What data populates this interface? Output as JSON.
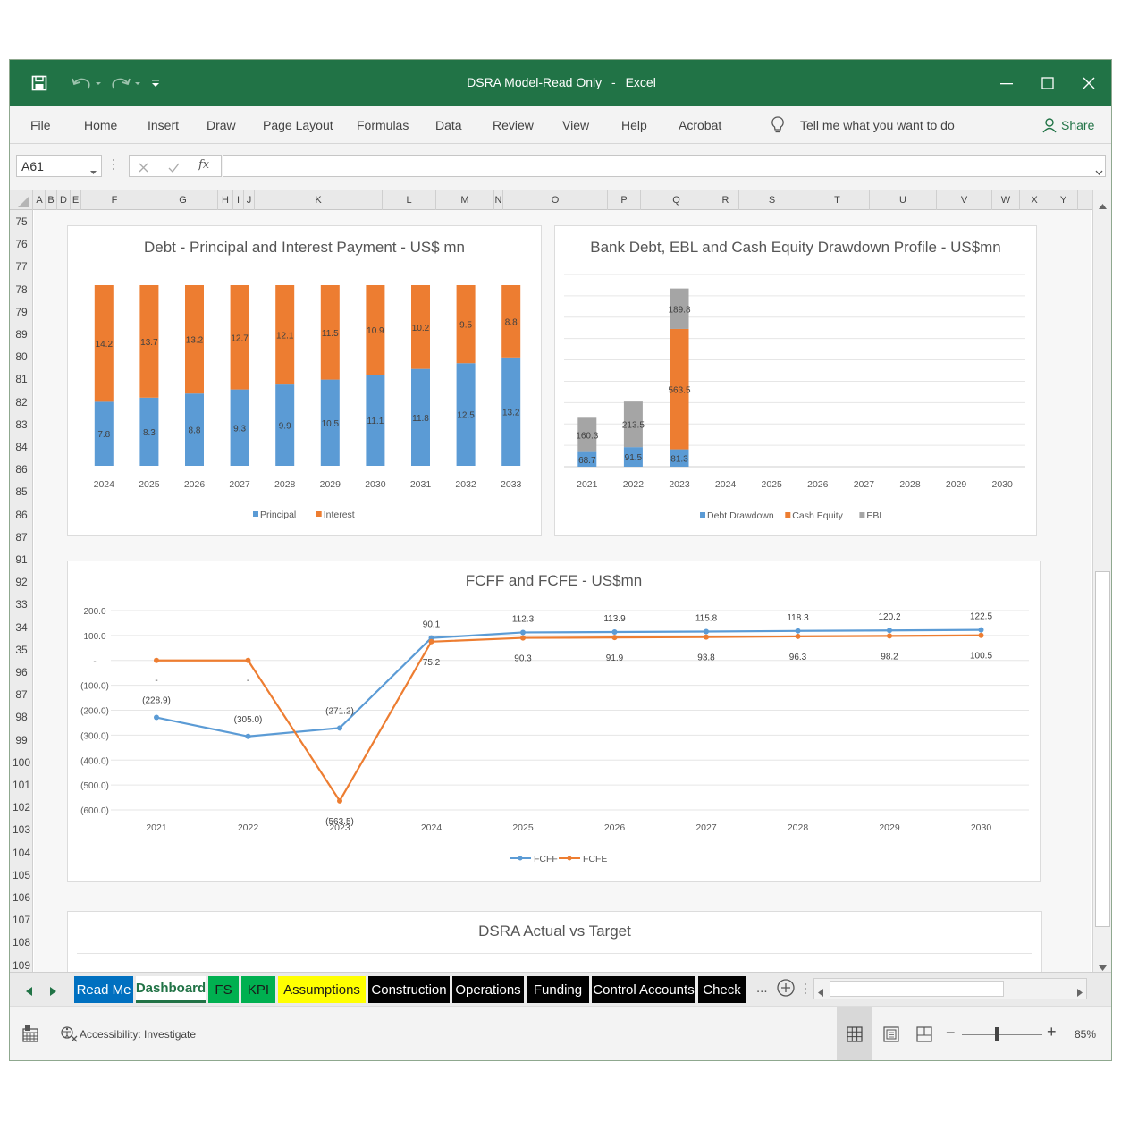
{
  "window": {
    "title": "DSRA Model-Read Only",
    "title_sep": "-",
    "app": "Excel",
    "brand_color": "#217346",
    "quick_access_icons": [
      "save-icon",
      "undo-icon",
      "redo-icon",
      "customize-icon"
    ],
    "window_controls": [
      "minimize-icon",
      "maximize-icon",
      "close-icon"
    ]
  },
  "ribbon": {
    "tabs": [
      "File",
      "Home",
      "Insert",
      "Draw",
      "Page Layout",
      "Formulas",
      "Data",
      "Review",
      "View",
      "Help",
      "Acrobat"
    ],
    "tell_me": "Tell me what you want to do",
    "share": "Share"
  },
  "formula_bar": {
    "name_box": "A61",
    "fx_label": "fx",
    "value": ""
  },
  "grid": {
    "columns": [
      "A",
      "B",
      "D",
      "E",
      "F",
      "G",
      "H",
      "I",
      "J",
      "K",
      "L",
      "M",
      "N",
      "O",
      "P",
      "Q",
      "R",
      "S",
      "T",
      "U",
      "V",
      "W",
      "X",
      "Y"
    ],
    "rows": [
      "75",
      "76",
      "77",
      "78",
      "79",
      "89",
      "80",
      "81",
      "82",
      "83",
      "84",
      "86",
      "85",
      "86",
      "87",
      "91",
      "92",
      "33",
      "34",
      "35",
      "96",
      "87",
      "98",
      "99",
      "100",
      "101",
      "102",
      "103",
      "104",
      "105",
      "106",
      "107",
      "108",
      "109"
    ]
  },
  "chart_data": [
    {
      "id": "chart1",
      "type": "bar",
      "stacked": true,
      "title": "Debt - Principal and Interest Payment - US$ mn",
      "categories": [
        "2024",
        "2025",
        "2026",
        "2027",
        "2028",
        "2029",
        "2030",
        "2031",
        "2032",
        "2033"
      ],
      "series": [
        {
          "name": "Principal",
          "color": "#5b9bd5",
          "values": [
            7.8,
            8.3,
            8.8,
            9.3,
            9.9,
            10.5,
            11.1,
            11.8,
            12.5,
            13.2
          ]
        },
        {
          "name": "Interest",
          "color": "#ed7d31",
          "values": [
            14.2,
            13.7,
            13.2,
            12.7,
            12.1,
            11.5,
            10.9,
            10.2,
            9.5,
            8.8
          ]
        }
      ],
      "ylim": [
        0,
        22
      ],
      "grid": false,
      "legend": "bottom"
    },
    {
      "id": "chart2",
      "type": "bar",
      "stacked": true,
      "title": "Bank Debt, EBL and Cash Equity Drawdown Profile - US$mn",
      "categories": [
        "2021",
        "2022",
        "2023",
        "2024",
        "2025",
        "2026",
        "2027",
        "2028",
        "2029",
        "2030"
      ],
      "series": [
        {
          "name": "Debt Drawdown",
          "color": "#5b9bd5",
          "values": [
            68.7,
            91.5,
            81.3,
            0,
            0,
            0,
            0,
            0,
            0,
            0
          ]
        },
        {
          "name": "Cash Equity",
          "color": "#ed7d31",
          "values": [
            0,
            0,
            563.5,
            0,
            0,
            0,
            0,
            0,
            0,
            0
          ]
        },
        {
          "name": "EBL",
          "color": "#a5a5a5",
          "values": [
            160.3,
            213.5,
            189.8,
            0,
            0,
            0,
            0,
            0,
            0,
            0
          ]
        }
      ],
      "ylim": [
        0,
        900
      ],
      "grid": true,
      "legend": "bottom"
    },
    {
      "id": "chart3",
      "type": "line",
      "title": "FCFF and FCFE - US$mn",
      "categories": [
        "2021",
        "2022",
        "2023",
        "2024",
        "2025",
        "2026",
        "2027",
        "2028",
        "2029",
        "2030"
      ],
      "yticks": [
        "200.0",
        "100.0",
        "-",
        "(100.0)",
        "(200.0)",
        "(300.0)",
        "(400.0)",
        "(500.0)",
        "(600.0)"
      ],
      "ylim": [
        -600,
        200
      ],
      "series": [
        {
          "name": "FCFF",
          "color": "#5b9bd5",
          "values": [
            -228.9,
            -305.0,
            -271.2,
            90.1,
            112.3,
            113.9,
            115.8,
            118.3,
            120.2,
            122.5
          ],
          "labels": [
            "(228.9)",
            "(305.0)",
            "(271.2)",
            "90.1",
            "112.3",
            "113.9",
            "115.8",
            "118.3",
            "120.2",
            "122.5"
          ]
        },
        {
          "name": "FCFE",
          "color": "#ed7d31",
          "values": [
            0,
            0,
            -563.5,
            75.2,
            90.3,
            91.9,
            93.8,
            96.3,
            98.2,
            100.5
          ],
          "labels": [
            "-",
            "-",
            "(563.5)",
            "75.2",
            "90.3",
            "91.9",
            "93.8",
            "96.3",
            "98.2",
            "100.5"
          ]
        }
      ],
      "grid": true,
      "legend": "bottom"
    },
    {
      "id": "chart4",
      "type": "bar",
      "title": "DSRA Actual vs Target"
    }
  ],
  "sheet_tabs": [
    {
      "label": "Read Me",
      "bg": "#0070c0",
      "fg": "#ffffff"
    },
    {
      "label": "Dashboard",
      "bg": "#ffffff",
      "fg": "#217346"
    },
    {
      "label": "FS",
      "bg": "#00b050",
      "fg": "#1a1a1a"
    },
    {
      "label": "KPI",
      "bg": "#00b050",
      "fg": "#1a1a1a"
    },
    {
      "label": "Assumptions",
      "bg": "#ffff00",
      "fg": "#1a1a1a"
    },
    {
      "label": "Construction",
      "bg": "#000000",
      "fg": "#ffffff"
    },
    {
      "label": "Operations",
      "bg": "#000000",
      "fg": "#ffffff"
    },
    {
      "label": "Funding",
      "bg": "#000000",
      "fg": "#ffffff"
    },
    {
      "label": "Control Accounts",
      "bg": "#000000",
      "fg": "#ffffff"
    },
    {
      "label": "Check",
      "bg": "#000000",
      "fg": "#ffffff"
    }
  ],
  "sheet_tabs_more": "...",
  "status": {
    "accessibility": "Accessibility: Investigate",
    "zoom_minus": "−",
    "zoom_plus": "+",
    "zoom": "85%"
  }
}
